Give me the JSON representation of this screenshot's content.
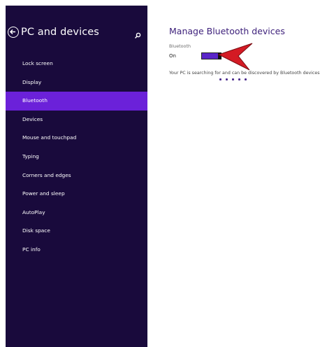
{
  "sidebar": {
    "title": "PC and devices",
    "items": [
      {
        "label": "Lock screen"
      },
      {
        "label": "Display"
      },
      {
        "label": "Bluetooth",
        "active": true
      },
      {
        "label": "Devices"
      },
      {
        "label": "Mouse and touchpad"
      },
      {
        "label": "Typing"
      },
      {
        "label": "Corners and edges"
      },
      {
        "label": "Power and sleep"
      },
      {
        "label": "AutoPlay"
      },
      {
        "label": "Disk space"
      },
      {
        "label": "PC info"
      }
    ],
    "icons": {
      "back": "back-arrow-icon",
      "search": "search-icon"
    }
  },
  "main": {
    "title": "Manage Bluetooth devices",
    "bluetooth_label": "Bluetooth",
    "bluetooth_state": "On",
    "status_text": "Your PC is searching for and can be discovered by Bluetooth devices"
  },
  "colors": {
    "sidebar_bg": "#190a3c",
    "active_item": "#6b21d9",
    "title": "#3c1f7a",
    "toggle_on": "#5a25c9",
    "annotation_arrow": "#d41a24"
  }
}
